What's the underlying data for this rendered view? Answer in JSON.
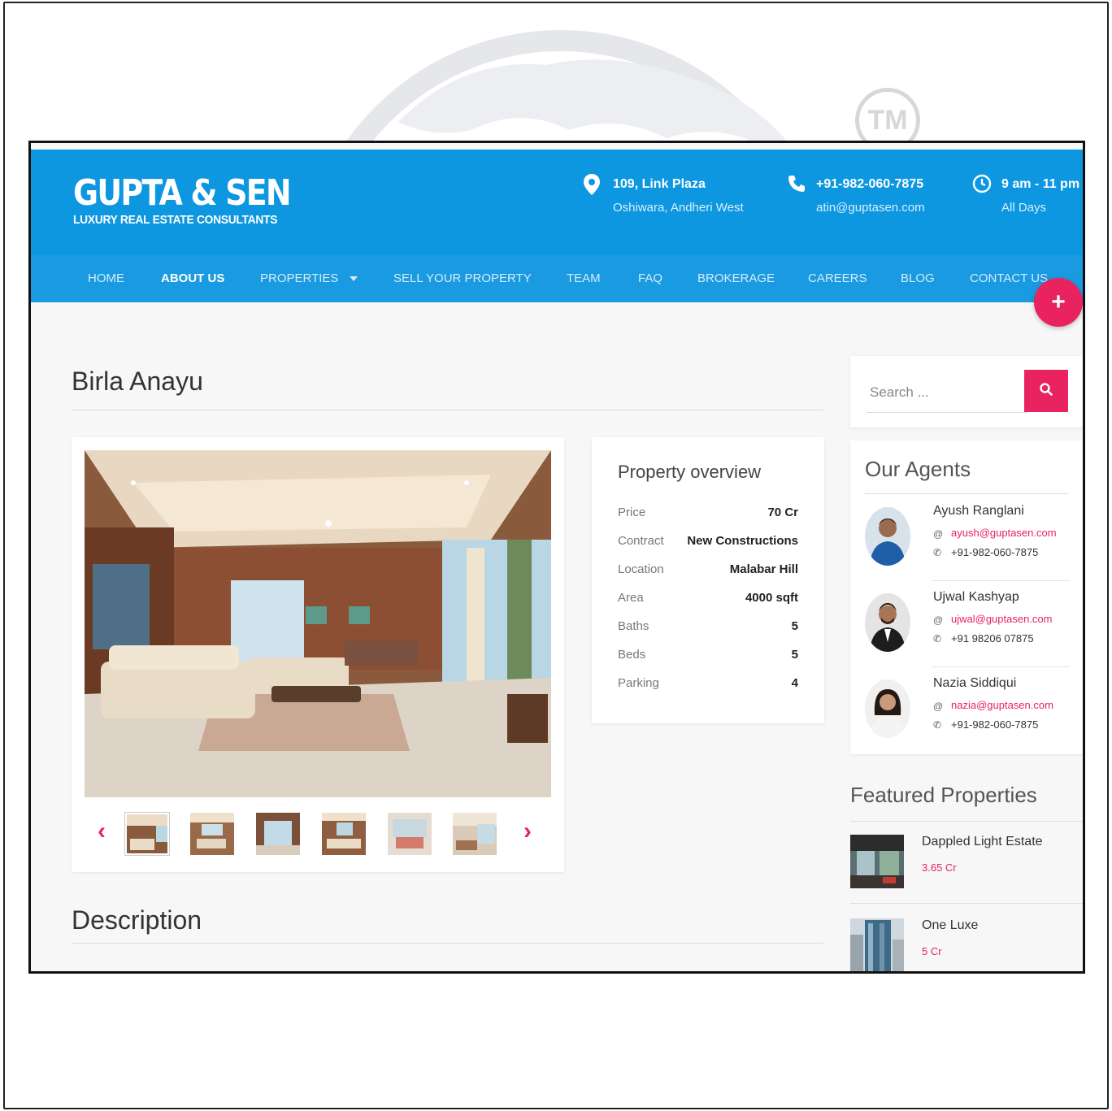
{
  "watermark": {
    "tm": "TM"
  },
  "brand": {
    "name": "GUPTA & SEN",
    "tagline": "LUXURY REAL ESTATE CONSULTANTS"
  },
  "contact": {
    "address_line1": "109, Link Plaza",
    "address_line2": "Oshiwara, Andheri West",
    "phone": "+91-982-060-7875",
    "email": "atin@guptasen.com",
    "hours": "9 am - 11 pm",
    "days": "All Days"
  },
  "nav": {
    "items": [
      "HOME",
      "ABOUT US",
      "PROPERTIES",
      "SELL YOUR PROPERTY",
      "TEAM",
      "FAQ",
      "BROKERAGE",
      "CAREERS",
      "BLOG",
      "CONTACT US"
    ],
    "active": "ABOUT US"
  },
  "fab": {
    "label": "+"
  },
  "property": {
    "title": "Birla Anayu",
    "overview_title": "Property overview",
    "overview": [
      {
        "label": "Price",
        "value": "70 Cr"
      },
      {
        "label": "Contract",
        "value": "New Constructions"
      },
      {
        "label": "Location",
        "value": "Malabar Hill"
      },
      {
        "label": "Area",
        "value": "4000 sqft"
      },
      {
        "label": "Baths",
        "value": "5"
      },
      {
        "label": "Beds",
        "value": "5"
      },
      {
        "label": "Parking",
        "value": "4"
      }
    ],
    "description_title": "Description"
  },
  "gallery": {
    "prev": "‹",
    "next": "›"
  },
  "search": {
    "placeholder": "Search ..."
  },
  "agents": {
    "title": "Our Agents",
    "list": [
      {
        "name": "Ayush Ranglani",
        "email": "ayush@guptasen.com",
        "phone": "+91-982-060-7875"
      },
      {
        "name": "Ujwal Kashyap",
        "email": "ujwal@guptasen.com",
        "phone": "+91 98206 07875"
      },
      {
        "name": "Nazia Siddiqui",
        "email": "nazia@guptasen.com",
        "phone": "+91-982-060-7875"
      }
    ]
  },
  "featured": {
    "title": "Featured Properties",
    "items": [
      {
        "name": "Dappled Light Estate",
        "price": "3.65 Cr"
      },
      {
        "name": "One Luxe",
        "price": "5 Cr"
      }
    ]
  },
  "colors": {
    "header_blue": "#0d97e0",
    "accent_pink": "#e8235f"
  }
}
